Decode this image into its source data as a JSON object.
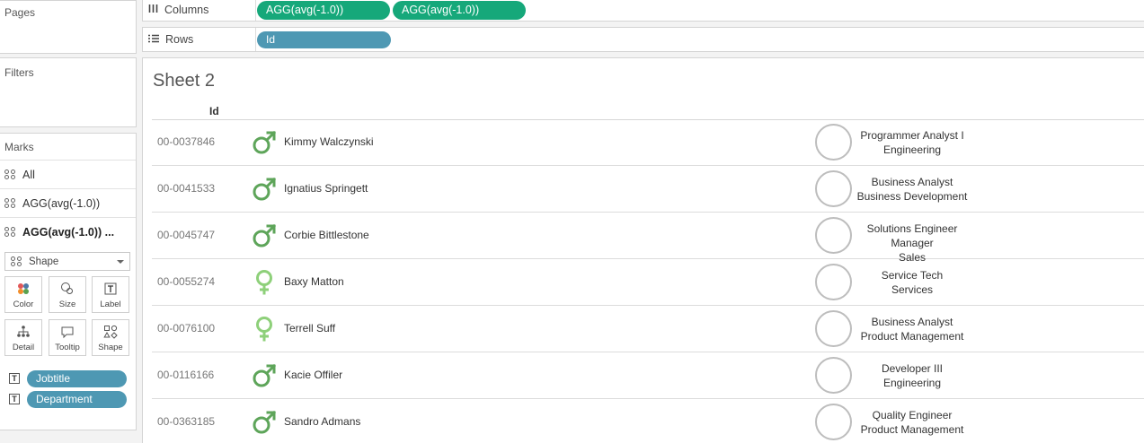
{
  "left": {
    "pages_title": "Pages",
    "filters_title": "Filters",
    "marks_title": "Marks",
    "marks_items": [
      "All",
      "AGG(avg(-1.0))",
      "AGG(avg(-1.0)) ..."
    ],
    "mark_type": "Shape",
    "buttons": {
      "color": "Color",
      "size": "Size",
      "label": "Label",
      "detail": "Detail",
      "tooltip": "Tooltip",
      "shape": "Shape"
    },
    "label_pills": [
      {
        "icon": "T",
        "label": "Jobtitle"
      },
      {
        "icon": "T",
        "label": "Department"
      }
    ]
  },
  "shelves": {
    "columns_label": "Columns",
    "columns_pills": [
      "AGG(avg(-1.0))",
      "AGG(avg(-1.0))"
    ],
    "rows_label": "Rows",
    "rows_pill": "Id"
  },
  "colors": {
    "green_pill": "#16a87a",
    "blue_pill": "#4e98b3",
    "male_shape": "#5ea55a",
    "female_shape": "#8ed07a"
  },
  "sheet": {
    "title": "Sheet 2",
    "column_header": "Id",
    "rows": [
      {
        "id": "00-0037846",
        "gender": "male",
        "name": "Kimmy Walczynski",
        "jobtitle": "Programmer Analyst I",
        "department": "Engineering"
      },
      {
        "id": "00-0041533",
        "gender": "male",
        "name": "Ignatius Springett",
        "jobtitle": "Business Analyst",
        "department": "Business Development"
      },
      {
        "id": "00-0045747",
        "gender": "male",
        "name": "Corbie Bittlestone",
        "jobtitle": "Solutions Engineer Manager",
        "department": "Sales"
      },
      {
        "id": "00-0055274",
        "gender": "female",
        "name": "Baxy Matton",
        "jobtitle": "Service Tech",
        "department": "Services"
      },
      {
        "id": "00-0076100",
        "gender": "female",
        "name": "Terrell Suff",
        "jobtitle": "Business Analyst",
        "department": "Product Management"
      },
      {
        "id": "00-0116166",
        "gender": "male",
        "name": "Kacie Offiler",
        "jobtitle": "Developer III",
        "department": "Engineering"
      },
      {
        "id": "00-0363185",
        "gender": "male",
        "name": "Sandro Admans",
        "jobtitle": "Quality Engineer",
        "department": "Product Management"
      }
    ]
  }
}
